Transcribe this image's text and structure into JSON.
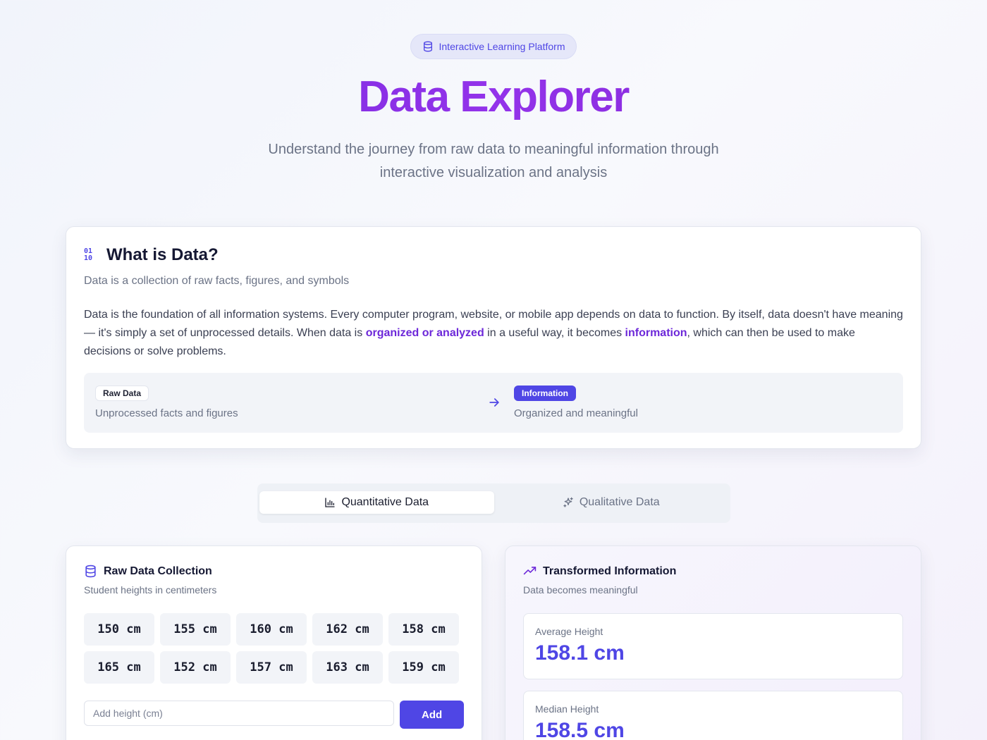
{
  "hero": {
    "badge": "Interactive Learning Platform",
    "title": "Data Explorer",
    "subtitle": "Understand the journey from raw data to meaningful information through interactive visualization and analysis"
  },
  "what_is_data": {
    "title": "What is Data?",
    "description": "Data is a collection of raw facts, figures, and symbols",
    "body_1": "Data is the foundation of all information systems. Every computer program, website, or mobile app depends on data to function. By itself, data doesn't have meaning — it's simply a set of unprocessed details. When data is ",
    "highlight_1": "organized or analyzed",
    "body_2": " in a useful way, it becomes ",
    "highlight_2": "information",
    "body_3": ", which can then be used to make decisions or solve problems.",
    "flow": {
      "raw_tag": "Raw Data",
      "raw_desc": "Unprocessed facts and figures",
      "info_tag": "Information",
      "info_desc": "Organized and meaningful"
    }
  },
  "tabs": [
    {
      "label": "Quantitative Data",
      "icon": "bar-chart-icon",
      "active": true
    },
    {
      "label": "Qualitative Data",
      "icon": "sparkles-icon",
      "active": false
    }
  ],
  "raw_data": {
    "title": "Raw Data Collection",
    "description": "Student heights in centimeters",
    "values": [
      "150 cm",
      "155 cm",
      "160 cm",
      "162 cm",
      "158 cm",
      "165 cm",
      "152 cm",
      "157 cm",
      "163 cm",
      "159 cm"
    ],
    "input_placeholder": "Add height (cm)",
    "add_label": "Add"
  },
  "transformed": {
    "title": "Transformed Information",
    "description": "Data becomes meaningful",
    "stats": [
      {
        "label": "Average Height",
        "value": "158.1 cm"
      },
      {
        "label": "Median Height",
        "value": "158.5 cm"
      }
    ]
  },
  "colors": {
    "accent": "#4f46e5",
    "highlight": "#6d28d9"
  }
}
